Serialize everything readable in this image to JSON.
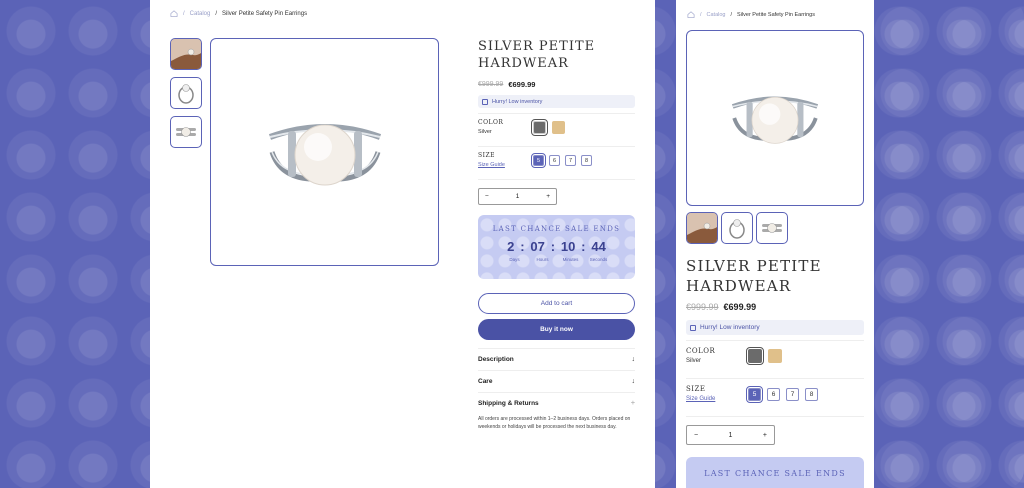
{
  "breadcrumb": {
    "home_icon": "home-icon",
    "catalog": "Catalog",
    "separator": "/",
    "current": "Silver Petite Safety Pin Earrings"
  },
  "product": {
    "title": "Silver Petite Hardwear",
    "old_price": "€999.99",
    "new_price": "€699.99",
    "low_inventory": "Hurry! Low inventory",
    "color_label": "Color",
    "color_value": "Silver",
    "colors": [
      "#6b6b6b",
      "#e0c08a"
    ],
    "size_label": "Size",
    "size_guide": "Size Guide",
    "sizes": [
      "5",
      "6",
      "7",
      "8"
    ],
    "selected_size": "5",
    "quantity": "1",
    "qty_minus": "−",
    "qty_plus": "+"
  },
  "countdown": {
    "title": "Last chance sale ends",
    "days": "2",
    "hours": "07",
    "minutes": "10",
    "seconds": "44",
    "days_label": "Days",
    "hours_label": "Hours",
    "minutes_label": "Minutes",
    "seconds_label": "Seconds",
    "colon": ":"
  },
  "actions": {
    "add_to_cart": "Add to cart",
    "buy_now": "Buy it now"
  },
  "accordion": {
    "description": "Description",
    "care": "Care",
    "shipping": "Shipping & Returns",
    "shipping_text": "All orders are processed within 1–2 business days. Orders placed on weekends or holidays will be processed the next business day.",
    "expand_symbol": "+",
    "collapsed_symbol": "+"
  },
  "colors": {
    "accent": "#5b63b7",
    "background": "#5b63b7",
    "countdown_bg": "#c5cbf2"
  }
}
